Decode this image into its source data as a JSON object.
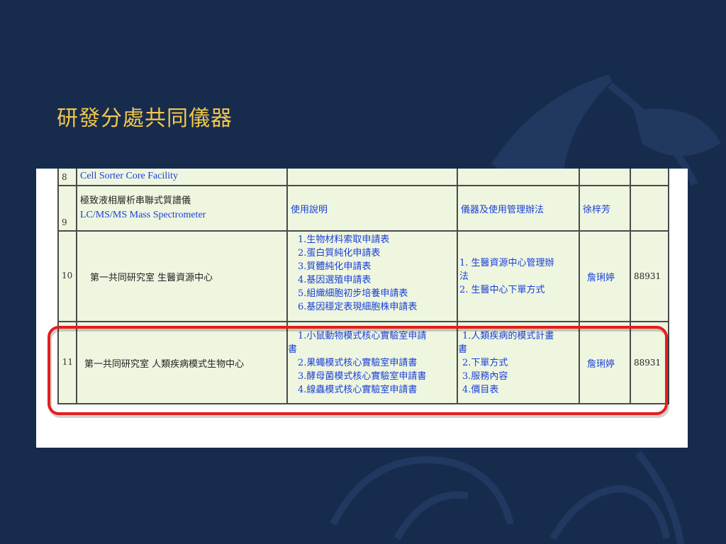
{
  "slide": {
    "title": "研發分處共同儀器"
  },
  "table": {
    "rows": [
      {
        "num": "8",
        "name_en": "Cell Sorter Core Facility"
      },
      {
        "num": "9",
        "name_zh": "極致液相層析串聯式質譜儀",
        "name_en": "LC/MS/MS Mass Spectrometer",
        "forms": "使用說明",
        "rules": "儀器及使用管理辦法",
        "contact": "徐梓芳",
        "ext": ""
      },
      {
        "num": "10",
        "name": "第一共同研究室 生醫資源中心",
        "forms": [
          "1.生物材料索取申請表",
          "2.蛋白質純化申請表",
          "3.質體純化申請表",
          "4.基因選殖申請表",
          "5.組織細胞初步培養申請表",
          "6.基因穩定表現細胞株申請表"
        ],
        "rules": [
          "1. 生醫資源中心管理辦",
          "法",
          "2. 生醫中心下單方式"
        ],
        "contact": "詹琍婷",
        "ext": "88931"
      },
      {
        "num": "11",
        "name": "第一共同研究室 人類疾病模式生物中心",
        "forms": [
          "1.小鼠動物模式核心實驗室申請",
          "書",
          "2.果蠅模式核心實驗室申請書",
          "3.酵母菌模式核心實驗室申請書",
          "4.線蟲模式核心實驗室申請書"
        ],
        "rules": [
          "1.人類疾病的模式計畫",
          "書",
          "2.下單方式",
          "3.服務內容",
          "4.價目表"
        ],
        "contact": "詹琍婷",
        "ext": "88931"
      }
    ]
  },
  "colors": {
    "background": "#172b4d",
    "title": "#f2c84b",
    "highlight": "#e41e1e",
    "link": "#1a3fd6",
    "table_bg": "#eef6e0"
  }
}
